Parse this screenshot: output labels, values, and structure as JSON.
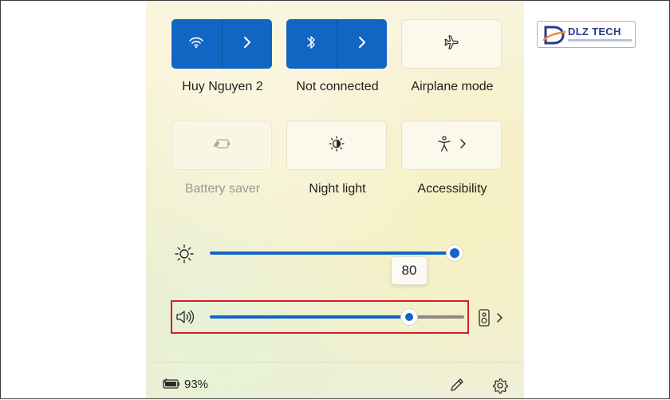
{
  "quick_settings": {
    "tiles": [
      {
        "label": "Huy Nguyen 2",
        "icon": "wifi-icon",
        "state": "on"
      },
      {
        "label": "Not connected",
        "icon": "bluetooth-icon",
        "state": "on"
      },
      {
        "label": "Airplane mode",
        "icon": "airplane-icon",
        "state": "off"
      },
      {
        "label": "Battery saver",
        "icon": "battery-saver-icon",
        "state": "disabled"
      },
      {
        "label": "Night light",
        "icon": "night-light-icon",
        "state": "off"
      },
      {
        "label": "Accessibility",
        "icon": "accessibility-icon",
        "state": "off"
      }
    ],
    "brightness": {
      "value": 80,
      "tooltip": "80"
    },
    "volume": {
      "value": 0.79
    },
    "footer": {
      "battery_percent": "93%"
    }
  },
  "logo": {
    "text": "DLZ TECH"
  },
  "colors": {
    "accent": "#1266c3",
    "highlight": "#d11f2b",
    "tile_light": "#fbf8ec"
  }
}
